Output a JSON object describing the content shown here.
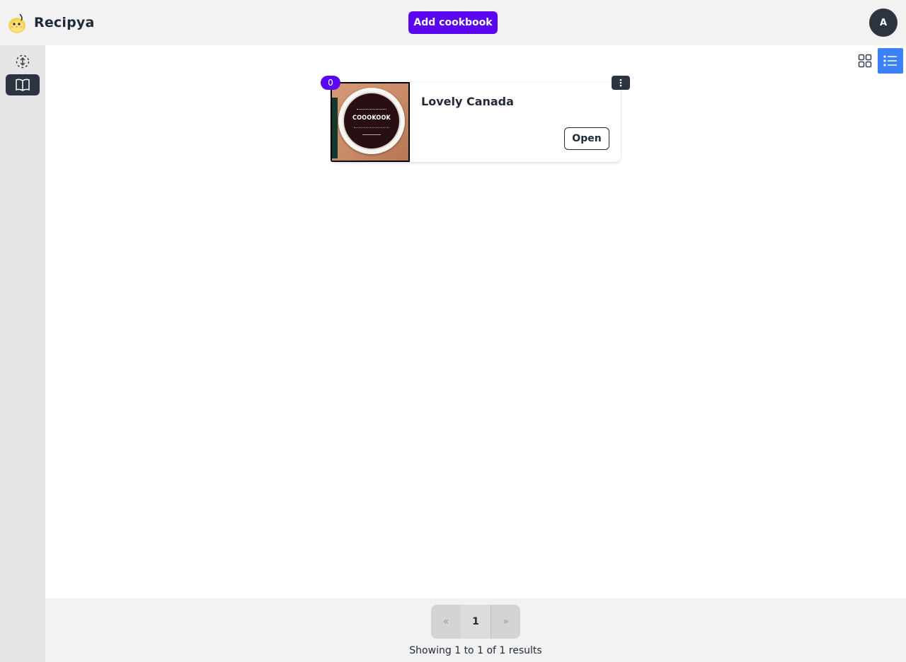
{
  "app": {
    "name": "Recipya",
    "logo_icon": "recipya-chick-logo-icon"
  },
  "header": {
    "add_button_label": "Add cookbook",
    "avatar_initial": "A"
  },
  "sidebar": {
    "items": [
      {
        "name": "recipes",
        "icon": "recipe-nav-icon",
        "active": false
      },
      {
        "name": "cookbooks",
        "icon": "open-book-icon",
        "active": true
      }
    ]
  },
  "view_toggle": {
    "options": [
      {
        "name": "grid",
        "icon": "grid-icon",
        "active": false
      },
      {
        "name": "list",
        "icon": "list-icon",
        "active": true
      }
    ]
  },
  "cookbooks": [
    {
      "title": "Lovely Canada",
      "recipe_count": "0",
      "cover_text": "COOOKOOK",
      "open_label": "Open"
    }
  ],
  "pagination": {
    "prev_label": "«",
    "current_page": "1",
    "next_label": "»",
    "results": {
      "prefix": "Showing",
      "from": "1",
      "to_word": "to",
      "to": "1",
      "of_word": "of",
      "total": "1",
      "suffix": "results"
    }
  },
  "colors": {
    "accent": "#5a06f0",
    "dark": "#2b3440",
    "active_view": "#3b82f6"
  }
}
